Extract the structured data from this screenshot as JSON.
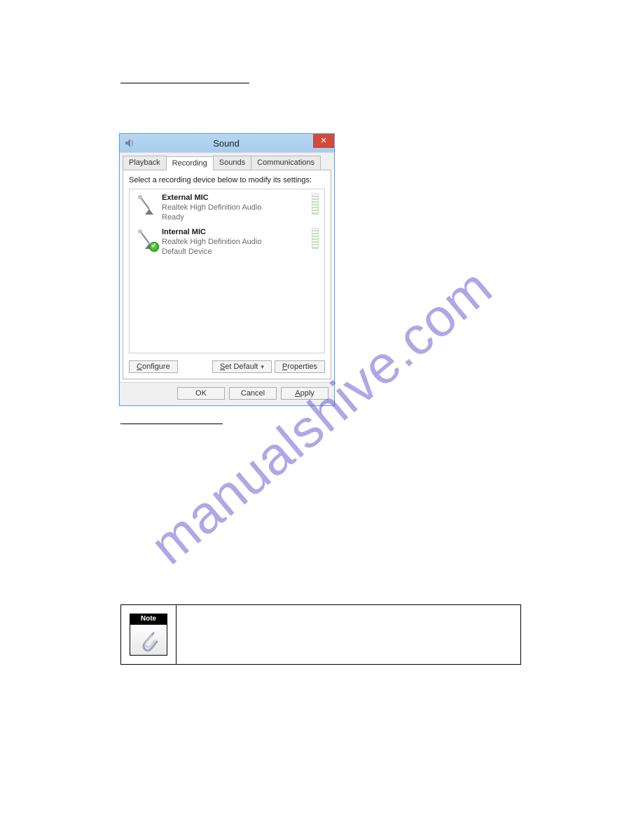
{
  "watermark": "manualshive.com",
  "dialog": {
    "title": "Sound",
    "tabs": [
      "Playback",
      "Recording",
      "Sounds",
      "Communications"
    ],
    "active_tab": "Recording",
    "panel_caption": "Select a recording device below to modify its settings:",
    "devices": [
      {
        "name": "External MIC",
        "driver": "Realtek High Definition Audio",
        "status": "Ready",
        "default": false
      },
      {
        "name": "Internal MIC",
        "driver": "Realtek High Definition Audio",
        "status": "Default Device",
        "default": true
      }
    ],
    "buttons": {
      "configure": "Configure",
      "set_default": "Set Default",
      "properties": "Properties",
      "ok": "OK",
      "cancel": "Cancel",
      "apply": "Apply"
    }
  },
  "note": {
    "head": "Note"
  }
}
